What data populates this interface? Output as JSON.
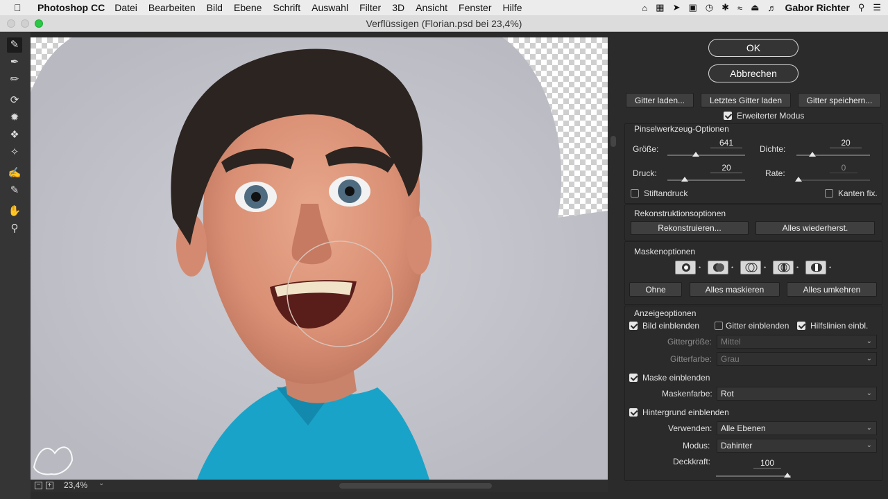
{
  "menubar": {
    "app_name": "Photoshop CC",
    "items": [
      "Datei",
      "Bearbeiten",
      "Bild",
      "Ebene",
      "Schrift",
      "Auswahl",
      "Filter",
      "3D",
      "Ansicht",
      "Fenster",
      "Hilfe"
    ],
    "user": "Gabor Richter"
  },
  "window": {
    "title": "Verflüssigen (Florian.psd bei 23,4%)"
  },
  "statusbar": {
    "zoom": "23,4%"
  },
  "panel": {
    "ok_label": "OK",
    "cancel_label": "Abbrechen",
    "load_mesh": "Gitter laden...",
    "load_last_mesh": "Letztes Gitter laden",
    "save_mesh": "Gitter speichern...",
    "advanced_mode": "Erweiterter Modus",
    "brush": {
      "header": "Pinselwerkzeug-Optionen",
      "size_label": "Größe:",
      "size_value": "641",
      "density_label": "Dichte:",
      "density_value": "20",
      "pressure_label": "Druck:",
      "pressure_value": "20",
      "rate_label": "Rate:",
      "rate_value": "0",
      "stylus_label": "Stiftandruck",
      "pin_edges_label": "Kanten fix."
    },
    "reconstruct": {
      "header": "Rekonstruktionsoptionen",
      "reconstruct_btn": "Rekonstruieren...",
      "restore_all_btn": "Alles wiederherst."
    },
    "mask": {
      "header": "Maskenoptionen",
      "none_btn": "Ohne",
      "mask_all_btn": "Alles maskieren",
      "invert_all_btn": "Alles umkehren"
    },
    "view": {
      "header": "Anzeigeoptionen",
      "show_image": "Bild einblenden",
      "show_mesh": "Gitter einblenden",
      "show_guides": "Hilfslinien einbl.",
      "mesh_size_label": "Gittergröße:",
      "mesh_size_value": "Mittel",
      "mesh_color_label": "Gitterfarbe:",
      "mesh_color_value": "Grau",
      "show_mask": "Maske einblenden",
      "mask_color_label": "Maskenfarbe:",
      "mask_color_value": "Rot",
      "show_backdrop": "Hintergrund einblenden",
      "use_label": "Verwenden:",
      "use_value": "Alle Ebenen",
      "mode_label": "Modus:",
      "mode_value": "Dahinter",
      "opacity_label": "Deckkraft:",
      "opacity_value": "100"
    }
  },
  "colors": {
    "accent_shirt": "#1aa3c8",
    "panel_bg": "#2b2b2b"
  }
}
